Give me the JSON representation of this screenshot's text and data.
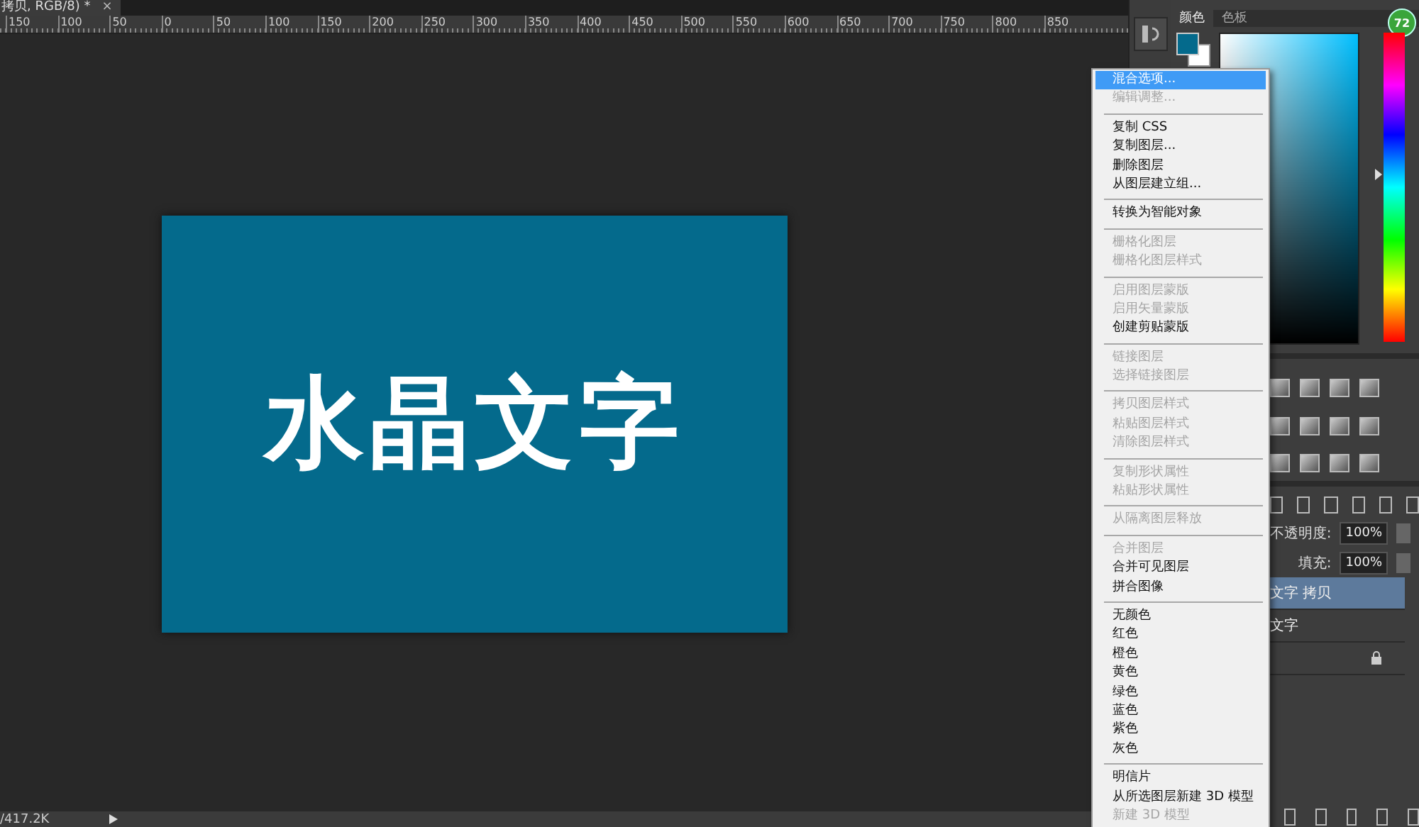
{
  "document": {
    "tab_title": "拷贝, RGB/8) *",
    "close": "×",
    "ruler_labels": [
      "150",
      "100",
      "50",
      "0",
      "50",
      "100",
      "150",
      "200",
      "250",
      "300",
      "350",
      "400",
      "450",
      "500",
      "550",
      "600",
      "650",
      "700",
      "750",
      "800",
      "850"
    ],
    "canvas_text": "水晶文字",
    "status": "/417.2K"
  },
  "color_panel": {
    "tabs": [
      {
        "label": "颜色",
        "selected": true
      },
      {
        "label": "色板",
        "selected": false
      }
    ],
    "badge": "72",
    "hue": {
      "level": 0.54
    }
  },
  "layers_panel": {
    "opacity_label": "不透明度:",
    "opacity": "100%",
    "fill_label": "填充:",
    "fill": "100%",
    "layers": [
      {
        "name": "文字 拷贝",
        "selected": true,
        "locked": false
      },
      {
        "name": "文字",
        "selected": false,
        "locked": false
      },
      {
        "selected": false,
        "locked": true
      }
    ]
  },
  "context_menu": {
    "groups": [
      [
        {
          "label": "混合选项...",
          "enabled": true,
          "selected": true
        },
        {
          "label": "编辑调整...",
          "enabled": false,
          "selected": false
        }
      ],
      [
        {
          "label": "复制 CSS",
          "enabled": true,
          "selected": false
        },
        {
          "label": "复制图层...",
          "enabled": true,
          "selected": false
        },
        {
          "label": "删除图层",
          "enabled": true,
          "selected": false
        },
        {
          "label": "从图层建立组...",
          "enabled": true,
          "selected": false
        }
      ],
      [
        {
          "label": "转换为智能对象",
          "enabled": true,
          "selected": false
        }
      ],
      [
        {
          "label": "栅格化图层",
          "enabled": false,
          "selected": false
        },
        {
          "label": "栅格化图层样式",
          "enabled": false,
          "selected": false
        }
      ],
      [
        {
          "label": "启用图层蒙版",
          "enabled": false,
          "selected": false
        },
        {
          "label": "启用矢量蒙版",
          "enabled": false,
          "selected": false
        },
        {
          "label": "创建剪贴蒙版",
          "enabled": true,
          "selected": false
        }
      ],
      [
        {
          "label": "链接图层",
          "enabled": false,
          "selected": false
        },
        {
          "label": "选择链接图层",
          "enabled": false,
          "selected": false
        }
      ],
      [
        {
          "label": "拷贝图层样式",
          "enabled": false,
          "selected": false
        },
        {
          "label": "粘贴图层样式",
          "enabled": false,
          "selected": false
        },
        {
          "label": "清除图层样式",
          "enabled": false,
          "selected": false
        }
      ],
      [
        {
          "label": "复制形状属性",
          "enabled": false,
          "selected": false
        },
        {
          "label": "粘贴形状属性",
          "enabled": false,
          "selected": false
        }
      ],
      [
        {
          "label": "从隔离图层释放",
          "enabled": false,
          "selected": false
        }
      ],
      [
        {
          "label": "合并图层",
          "enabled": false,
          "selected": false
        },
        {
          "label": "合并可见图层",
          "enabled": true,
          "selected": false
        },
        {
          "label": "拼合图像",
          "enabled": true,
          "selected": false
        }
      ],
      [
        {
          "label": "无颜色",
          "enabled": true,
          "selected": false
        },
        {
          "label": "红色",
          "enabled": true,
          "selected": false
        },
        {
          "label": "橙色",
          "enabled": true,
          "selected": false
        },
        {
          "label": "黄色",
          "enabled": true,
          "selected": false
        },
        {
          "label": "绿色",
          "enabled": true,
          "selected": false
        },
        {
          "label": "蓝色",
          "enabled": true,
          "selected": false
        },
        {
          "label": "紫色",
          "enabled": true,
          "selected": false
        },
        {
          "label": "灰色",
          "enabled": true,
          "selected": false
        }
      ],
      [
        {
          "label": "明信片",
          "enabled": true,
          "selected": false
        },
        {
          "label": "从所选图层新建 3D 模型",
          "enabled": true,
          "selected": false
        },
        {
          "label": "新建 3D 模型",
          "enabled": false,
          "selected": false
        }
      ]
    ]
  }
}
